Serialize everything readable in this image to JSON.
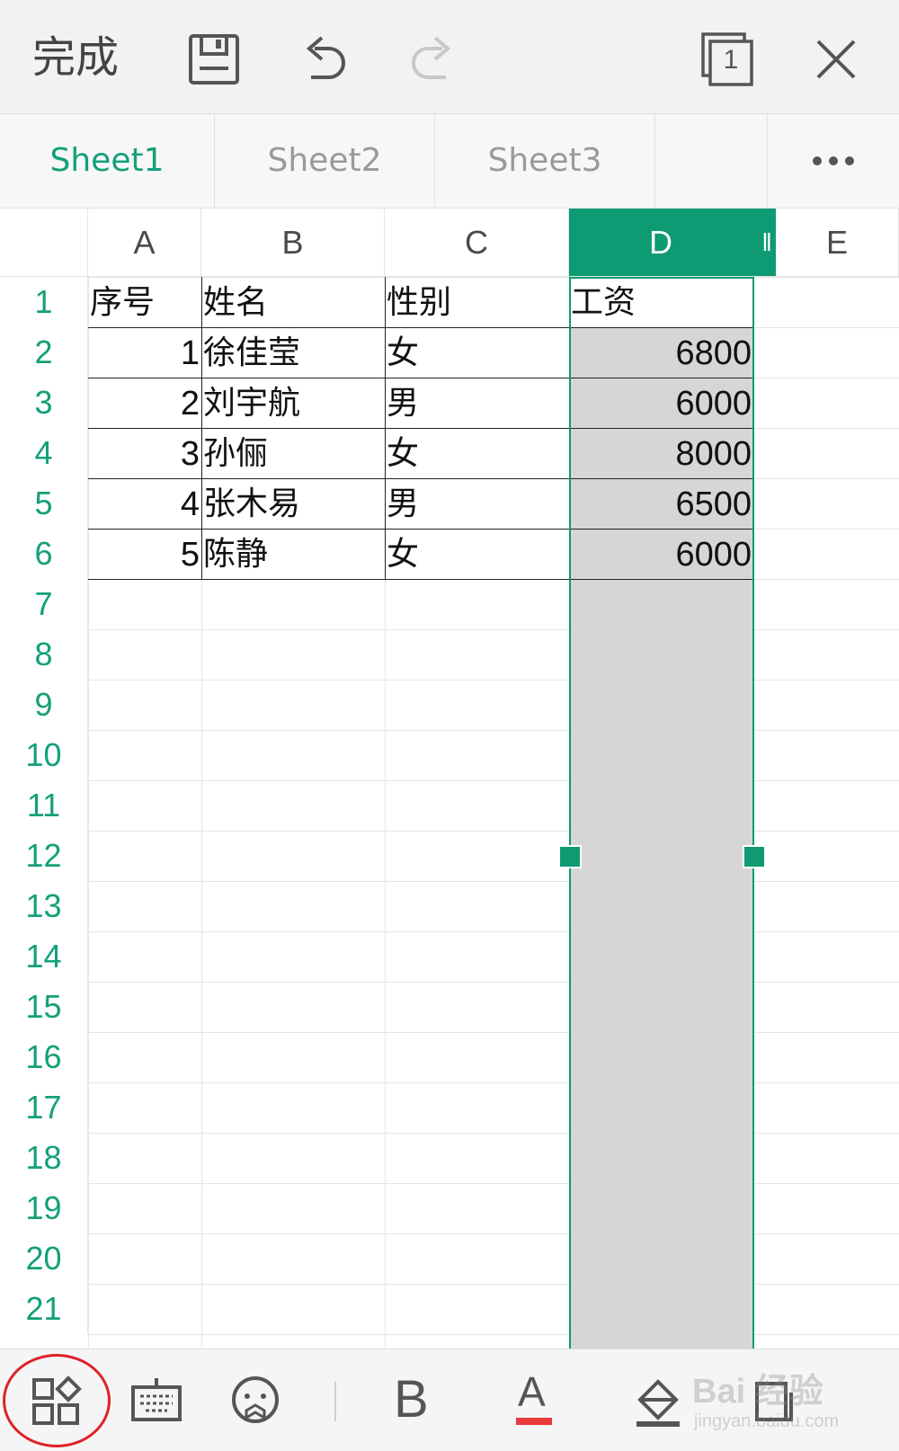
{
  "toolbar": {
    "done_label": "完成",
    "icons": [
      "save-icon",
      "undo-icon",
      "redo-icon",
      "window-count-icon",
      "close-icon"
    ],
    "window_count": "1"
  },
  "tabs": [
    {
      "label": "Sheet1",
      "active": true
    },
    {
      "label": "Sheet2",
      "active": false
    },
    {
      "label": "Sheet3",
      "active": false
    }
  ],
  "columns": [
    "A",
    "B",
    "C",
    "D",
    "E"
  ],
  "selected_column": "D",
  "rows": [
    "1",
    "2",
    "3",
    "4",
    "5",
    "6",
    "7",
    "8",
    "9",
    "10",
    "11",
    "12",
    "13",
    "14",
    "15",
    "16",
    "17",
    "18",
    "19",
    "20",
    "21"
  ],
  "table": {
    "header": [
      "序号",
      "姓名",
      "性别",
      "工资"
    ],
    "records": [
      [
        "1",
        "徐佳莹",
        "女",
        "6800"
      ],
      [
        "2",
        "刘宇航",
        "男",
        "6000"
      ],
      [
        "3",
        "孙俪",
        "女",
        "8000"
      ],
      [
        "4",
        "张木易",
        "男",
        "6500"
      ],
      [
        "5",
        "陈静",
        "女",
        "6000"
      ]
    ]
  },
  "bottombar": {
    "icons": [
      "apps-icon",
      "keyboard-icon",
      "emoji-icon",
      "bold-icon",
      "font-color-icon",
      "fill-color-icon",
      "more-icon"
    ],
    "bold_label": "B",
    "font_color_label": "A"
  },
  "watermark": {
    "text": "Bai 经验",
    "sub": "jingyan.baidu.com"
  },
  "colors": {
    "accent": "#0e9a72",
    "selection_fill": "#d6d6d6",
    "font_color_underline": "#e8393b",
    "annotation": "#e0202a"
  }
}
